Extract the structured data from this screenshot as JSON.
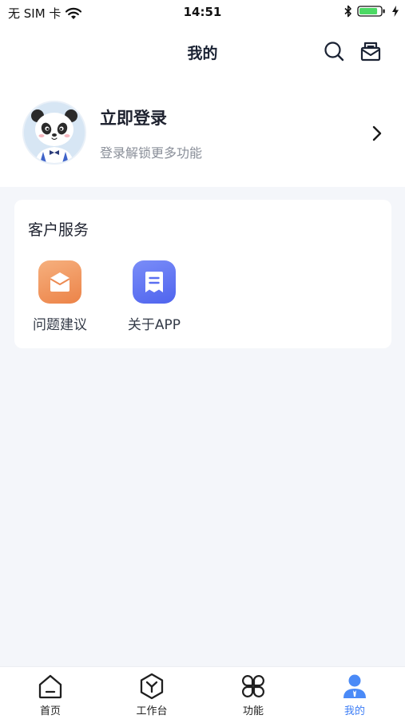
{
  "status_bar": {
    "carrier": "无 SIM 卡",
    "time": "14:51",
    "wifi_icon": "wifi-icon",
    "bluetooth_icon": "bluetooth-icon",
    "battery_icon": "battery-charging-icon",
    "battery_level": 0.85
  },
  "nav": {
    "title": "我的",
    "search_icon": "search-icon",
    "message_icon": "message-icon"
  },
  "profile": {
    "title": "立即登录",
    "subtitle": "登录解锁更多功能",
    "avatar": "panda-avatar",
    "arrow_icon": "chevron-right-icon"
  },
  "service": {
    "title": "客户服务",
    "items": [
      {
        "label": "问题建议",
        "icon": "envelope-icon",
        "color": "#ef9356"
      },
      {
        "label": "关于APP",
        "icon": "document-icon",
        "color": "#5d73f4"
      }
    ]
  },
  "tabs": [
    {
      "label": "首页",
      "icon": "home-icon",
      "active": false
    },
    {
      "label": "工作台",
      "icon": "workbench-icon",
      "active": false
    },
    {
      "label": "功能",
      "icon": "grid-icon",
      "active": false
    },
    {
      "label": "我的",
      "icon": "user-icon",
      "active": true
    }
  ],
  "colors": {
    "accent": "#3d7ef6",
    "background": "#f4f6fa"
  }
}
